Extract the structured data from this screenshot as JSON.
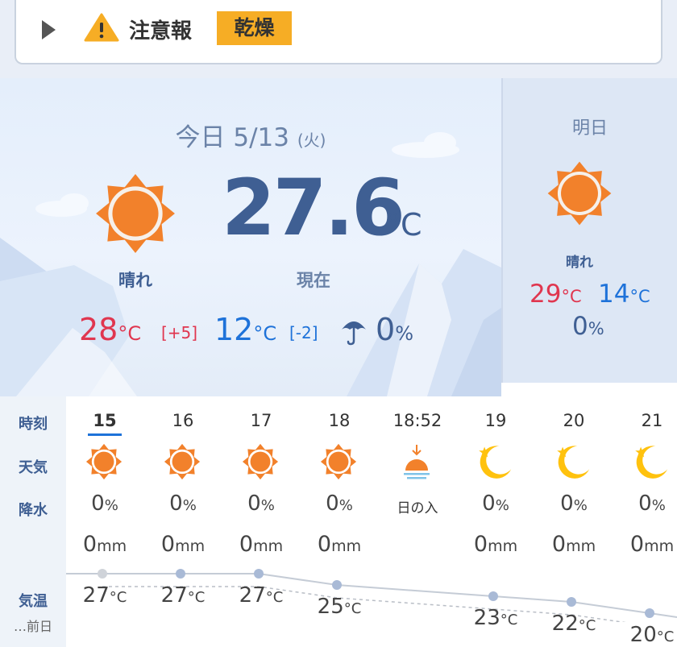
{
  "alert": {
    "title": "注意報",
    "badge": "乾燥"
  },
  "today": {
    "date": "今日 5/13",
    "weekday": "(火)",
    "condition": "晴れ",
    "current_temp": "27.6",
    "current_unit": "°C",
    "current_label": "現在",
    "high": "28",
    "high_diff": "[+5]",
    "low": "12",
    "low_diff": "[-2]",
    "precip": "0",
    "unit_c": "°C",
    "unit_pct": "%"
  },
  "tomorrow": {
    "label": "明日",
    "condition": "晴れ",
    "high": "29",
    "low": "14",
    "precip": "0",
    "unit_c": "°C",
    "unit_pct": "%"
  },
  "hourly": {
    "row_labels": {
      "time": "時刻",
      "weather": "天気",
      "precip": "降水",
      "temp": "気温",
      "prev": "…前日"
    },
    "units": {
      "pct": "%",
      "mm": "mm",
      "c": "°C"
    },
    "hours": [
      {
        "time": "15",
        "icon": "sun-icon",
        "precip": "0",
        "mm": "0",
        "temp": "27",
        "temp_value": 27,
        "current": true
      },
      {
        "time": "16",
        "icon": "sun-icon",
        "precip": "0",
        "mm": "0",
        "temp": "27",
        "temp_value": 27
      },
      {
        "time": "17",
        "icon": "sun-icon",
        "precip": "0",
        "mm": "0",
        "temp": "27",
        "temp_value": 27
      },
      {
        "time": "18",
        "icon": "sun-icon",
        "precip": "0",
        "mm": "0",
        "temp": "25",
        "temp_value": 25
      },
      {
        "time": "18:52",
        "icon": "sunset-icon",
        "event": "日の入"
      },
      {
        "time": "19",
        "icon": "moon-icon",
        "precip": "0",
        "mm": "0",
        "temp": "23",
        "temp_value": 23
      },
      {
        "time": "20",
        "icon": "moon-icon",
        "precip": "0",
        "mm": "0",
        "temp": "22",
        "temp_value": 22
      },
      {
        "time": "21",
        "icon": "moon-icon",
        "precip": "0",
        "mm": "0",
        "temp": "20",
        "temp_value": 20
      }
    ]
  },
  "colors": {
    "navy": "#3f5f93",
    "high_red": "#e0364f",
    "low_blue": "#1e72d9",
    "alert_badge": "#f6ad25",
    "sun_orange": "#f2812b",
    "moon_yellow": "#ffc20e"
  }
}
